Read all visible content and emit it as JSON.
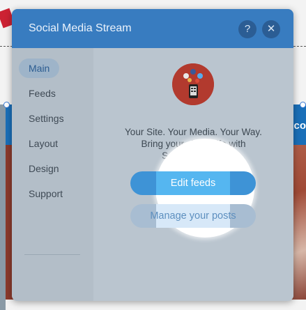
{
  "dialog": {
    "title": "Social Media Stream",
    "help_icon": "?",
    "close_icon": "✕"
  },
  "sidebar": {
    "items": [
      {
        "label": "Main",
        "active": true
      },
      {
        "label": "Feeds"
      },
      {
        "label": "Settings"
      },
      {
        "label": "Layout"
      },
      {
        "label": "Design"
      },
      {
        "label": "Support"
      }
    ]
  },
  "main": {
    "tagline_line1": "Your Site. Your Media. Your Way.",
    "tagline_line2": "Bring your site to life with",
    "tagline_line3": "Social Streams",
    "primary_button": "Edit feeds",
    "secondary_button": "Manage your posts"
  },
  "background": {
    "banner_text": "co"
  },
  "colors": {
    "header": "#387cc0",
    "primary_button": "#3e93d6",
    "accent_text": "#2b5c91"
  }
}
